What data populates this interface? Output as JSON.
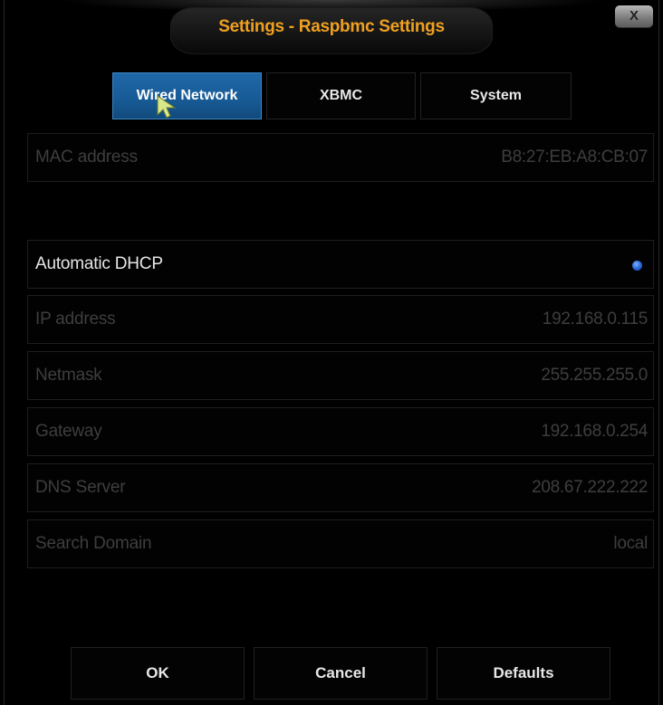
{
  "window": {
    "title": "Settings - Raspbmc Settings",
    "close_label": "X"
  },
  "tabs": [
    {
      "label": "Wired Network",
      "active": true
    },
    {
      "label": "XBMC",
      "active": false
    },
    {
      "label": "System",
      "active": false
    }
  ],
  "settings": {
    "mac": {
      "label": "MAC address",
      "value": "B8:27:EB:A8:CB:07"
    },
    "dhcp": {
      "label": "Automatic DHCP",
      "selected": true
    },
    "ip": {
      "label": "IP address",
      "value": "192.168.0.115"
    },
    "netmask": {
      "label": "Netmask",
      "value": "255.255.255.0"
    },
    "gateway": {
      "label": "Gateway",
      "value": "192.168.0.254"
    },
    "dns": {
      "label": "DNS Server",
      "value": "208.67.222.222"
    },
    "domain": {
      "label": "Search Domain",
      "value": "local"
    }
  },
  "buttons": {
    "ok": "OK",
    "cancel": "Cancel",
    "defaults": "Defaults"
  },
  "colors": {
    "title": "#f0a020",
    "active_tab": "#1a5f9e",
    "radio": "#2f6fe0",
    "disabled_text": "#3e3e3e",
    "enabled_text": "#e6e6e6"
  },
  "icons": {
    "cursor": "mouse-pointer-icon",
    "close": "close-icon",
    "radio": "radio-selected-icon"
  }
}
